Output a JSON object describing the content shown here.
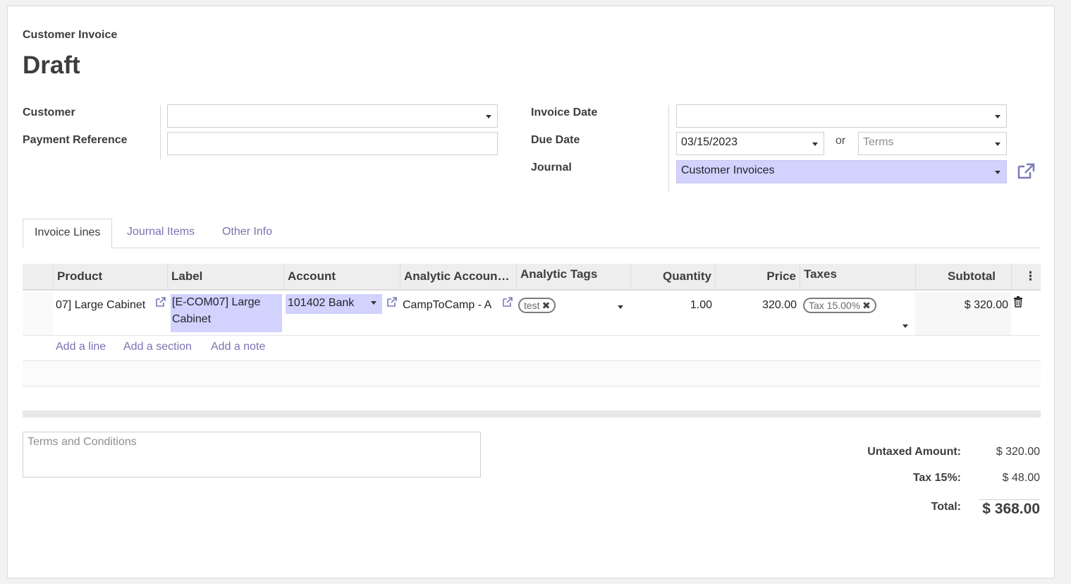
{
  "header": {
    "doc_type": "Customer Invoice",
    "status": "Draft"
  },
  "left_fields": {
    "customer_label": "Customer",
    "customer_value": "",
    "payment_ref_label": "Payment Reference",
    "payment_ref_value": ""
  },
  "right_fields": {
    "invoice_date_label": "Invoice Date",
    "invoice_date_value": "",
    "due_date_label": "Due Date",
    "due_date_value": "03/15/2023",
    "or_text": "or",
    "terms_placeholder": "Terms",
    "journal_label": "Journal",
    "journal_value": "Customer Invoices"
  },
  "tabs": [
    "Invoice Lines",
    "Journal Items",
    "Other Info"
  ],
  "table": {
    "columns": [
      "Product",
      "Label",
      "Account",
      "Analytic Accoun…",
      "Analytic Tags",
      "Quantity",
      "Price",
      "Taxes",
      "Subtotal"
    ],
    "row": {
      "product": "07] Large Cabinet",
      "label": "[E-COM07] Large Cabinet",
      "account": "101402 Bank",
      "analytic_account": "CampToCamp - A",
      "analytic_tag": "test",
      "quantity": "1.00",
      "price": "320.00",
      "tax": "Tax 15.00%",
      "subtotal": "$ 320.00"
    },
    "add_links": [
      "Add a line",
      "Add a section",
      "Add a note"
    ]
  },
  "terms_placeholder": "Terms and Conditions",
  "totals": {
    "untaxed_label": "Untaxed Amount:",
    "untaxed_value": "$ 320.00",
    "tax_label": "Tax 15%:",
    "tax_value": "$ 48.00",
    "total_label": "Total:",
    "total_value": "$ 368.00"
  },
  "colors": {
    "accent": "#7a73b3",
    "highlight": "#d2d2ff"
  }
}
